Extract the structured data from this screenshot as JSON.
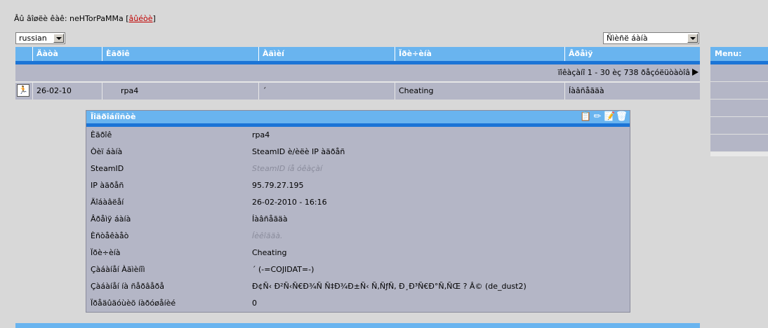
{
  "user": {
    "prefix": "Âû âîøëè êàê: neHTorPaMMa",
    "logout": "âûéòè"
  },
  "language_select": {
    "value": "russian"
  },
  "search_select": {
    "value": "Ñìèñë áàíà"
  },
  "table": {
    "columns": [
      "Äàòà",
      "Èãðîê",
      "Àäìèí",
      "Ïðè÷èíà",
      "Âðåìÿ"
    ],
    "pager_text": "ïîêàçàíî 1 - 30 èç 738 ðåçóëüòàòîâ",
    "row": {
      "date": "26-02-10",
      "player": "rpa4",
      "admin": "´",
      "reason": "Cheating",
      "length": "Íàâñåãäà"
    }
  },
  "details": {
    "title": "Ïîäðîáíîñòè",
    "rows": [
      {
        "label": "Èãðîê",
        "value": "rpa4"
      },
      {
        "label": "Òèï áàíà",
        "value": "SteamID è/èëè IP àäðåñ"
      },
      {
        "label": "SteamID",
        "value": "SteamID íå óêàçàí"
      },
      {
        "label": "IP àäðåñ",
        "value": "95.79.27.195"
      },
      {
        "label": "Äîáàâëåí",
        "value": "26-02-2010 - 16:16"
      },
      {
        "label": "Âðåìÿ áàíà",
        "value": "Íàâñåãäà"
      },
      {
        "label": "Èñòåêàåò",
        "value": "Íèêîãäà."
      },
      {
        "label": "Ïðè÷èíà",
        "value": "Cheating"
      },
      {
        "label": "Çàáàíåí Àäìèíîì",
        "value": "´ (-=COJIDAT=-)"
      },
      {
        "label": "Çàáàíåí íà ñåðâåðå",
        "value": "Ð¢Ñ‹ Ð²Ñ‹Ñ€Ð¾Ñ Ñ‡Ð¾Ð±Ñ‹ Ñ‚ÑƒÑ‚ Ð¸Ð³Ñ€Ð°Ñ‚ÑŒ ? Â© (de_dust2)"
      },
      {
        "label": "Ïðåäûäóùèõ íàðóøåíèé",
        "value": "0"
      }
    ]
  },
  "menu": {
    "title": "Menu:",
    "item_count": 5
  }
}
